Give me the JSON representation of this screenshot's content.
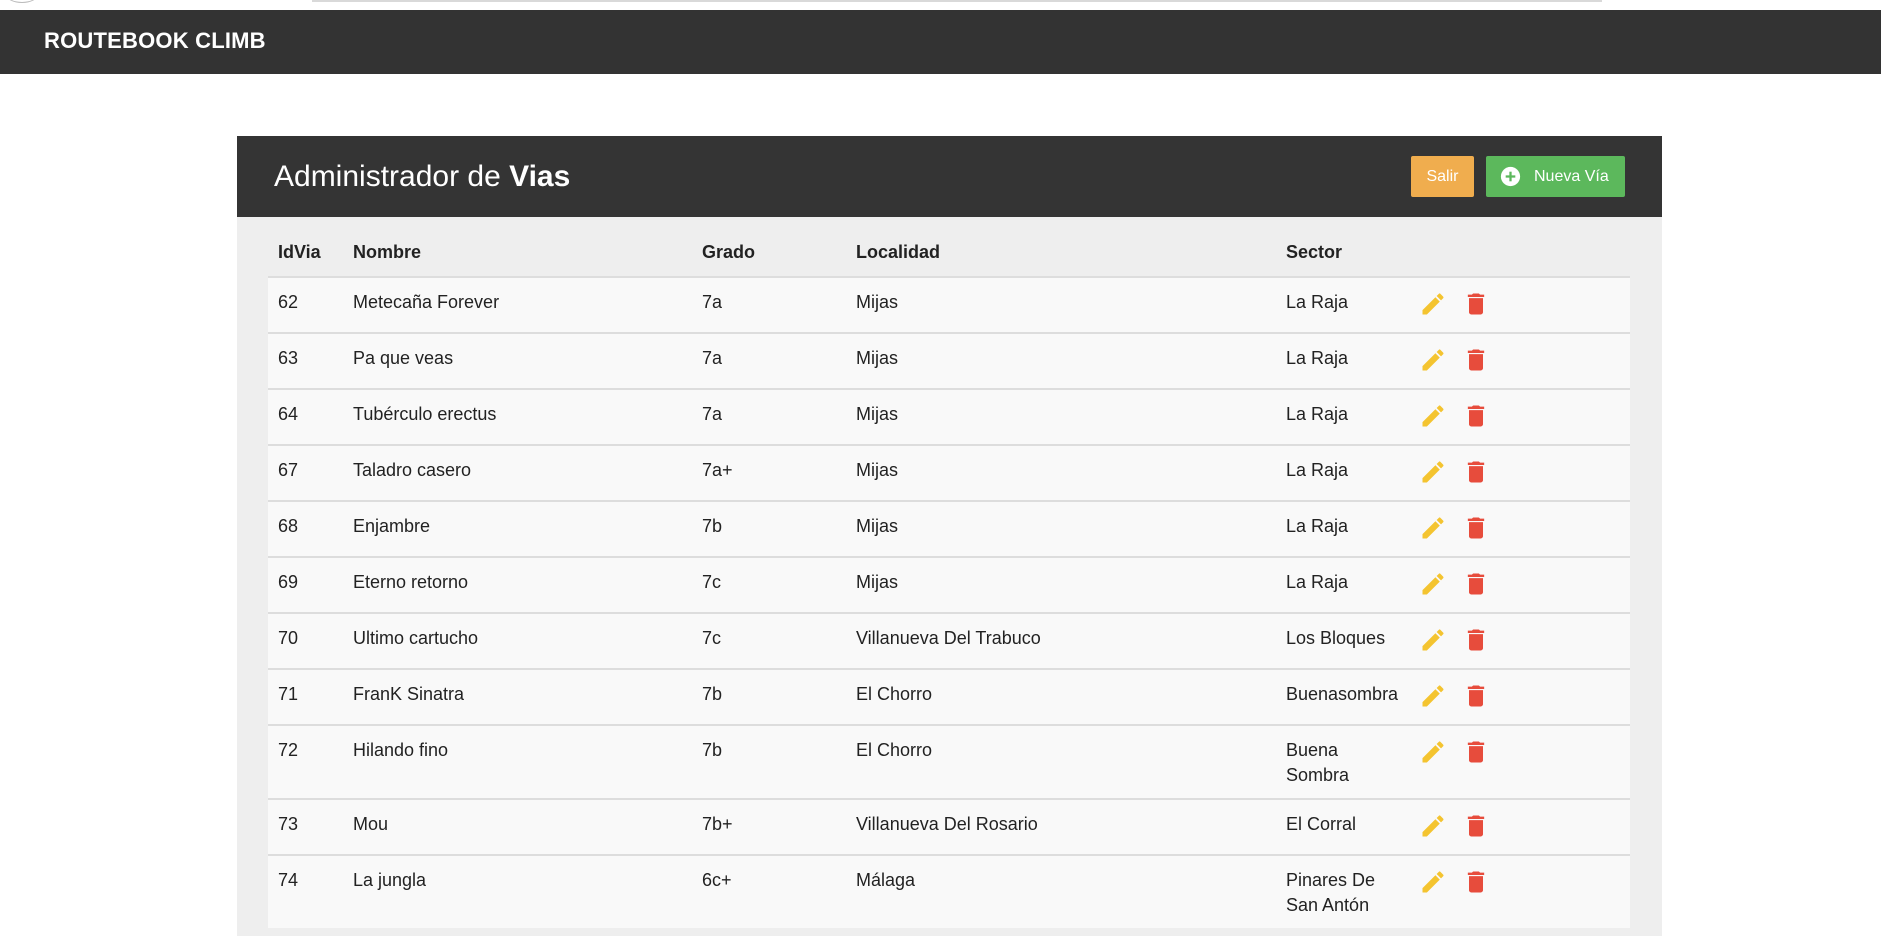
{
  "app": {
    "brand": "ROUTEBOOK CLIMB"
  },
  "panel": {
    "title_prefix": "Administrador de",
    "title_strong": "Vias",
    "salir_label": "Salir",
    "nueva_label": "Nueva Vía"
  },
  "table": {
    "headers": [
      "IdVia",
      "Nombre",
      "Grado",
      "Localidad",
      "Sector",
      ""
    ],
    "rows": [
      {
        "id": "62",
        "nombre": "Metecaña Forever",
        "grado": "7a",
        "localidad": "Mijas",
        "sector": "La Raja"
      },
      {
        "id": "63",
        "nombre": "Pa que veas",
        "grado": "7a",
        "localidad": "Mijas",
        "sector": "La Raja"
      },
      {
        "id": "64",
        "nombre": "Tubérculo erectus",
        "grado": "7a",
        "localidad": "Mijas",
        "sector": "La Raja"
      },
      {
        "id": "67",
        "nombre": "Taladro casero",
        "grado": "7a+",
        "localidad": "Mijas",
        "sector": "La Raja"
      },
      {
        "id": "68",
        "nombre": "Enjambre",
        "grado": "7b",
        "localidad": "Mijas",
        "sector": "La Raja"
      },
      {
        "id": "69",
        "nombre": "Eterno retorno",
        "grado": "7c",
        "localidad": "Mijas",
        "sector": "La Raja"
      },
      {
        "id": "70",
        "nombre": "Ultimo cartucho",
        "grado": "7c",
        "localidad": "Villanueva Del Trabuco",
        "sector": "Los Bloques"
      },
      {
        "id": "71",
        "nombre": "FranK Sinatra",
        "grado": "7b",
        "localidad": "El Chorro",
        "sector": "Buenasombra"
      },
      {
        "id": "72",
        "nombre": "Hilando fino",
        "grado": "7b",
        "localidad": "El Chorro",
        "sector": "Buena Sombra"
      },
      {
        "id": "73",
        "nombre": "Mou",
        "grado": "7b+",
        "localidad": "Villanueva Del Rosario",
        "sector": "El Corral"
      },
      {
        "id": "74",
        "nombre": "La jungla",
        "grado": "6c+",
        "localidad": "Málaga",
        "sector": "Pinares De San Antón"
      }
    ]
  },
  "icons": {
    "edit": "pencil-icon",
    "delete": "trash-icon",
    "add": "plus-circle-icon"
  },
  "colors": {
    "navbar": "#333333",
    "salir": "#f0ad4e",
    "nueva": "#5cb85c",
    "edit_icon": "#f4c430",
    "delete_icon": "#e74c3c"
  }
}
